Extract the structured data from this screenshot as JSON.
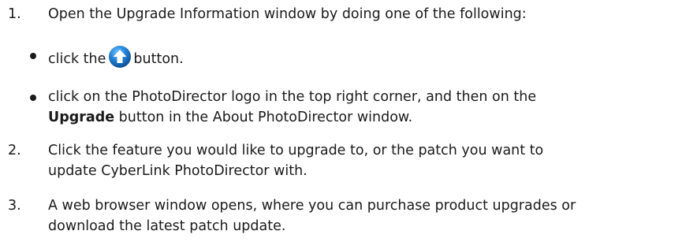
{
  "steps": [
    {
      "number": "1.",
      "text": "Open the Upgrade Information window by doing one of the following:",
      "bullets": [
        {
          "before": "click the",
          "icon": "upgrade-arrow-icon",
          "after": "button."
        },
        {
          "line1": "click on the PhotoDirector logo in the top right corner, and then on the",
          "bold": "Upgrade",
          "line2_rest": " button in the About PhotoDirector window."
        }
      ]
    },
    {
      "number": "2.",
      "line1": "Click the feature you would like to upgrade to, or the patch you want to",
      "line2": "update CyberLink PhotoDirector with."
    },
    {
      "number": "3.",
      "line1": "A web browser window opens, where you can purchase product upgrades or",
      "line2": "download the latest patch update."
    }
  ],
  "colors": {
    "text": "#1a1a1a",
    "icon_blue": "#1f7fd4"
  }
}
